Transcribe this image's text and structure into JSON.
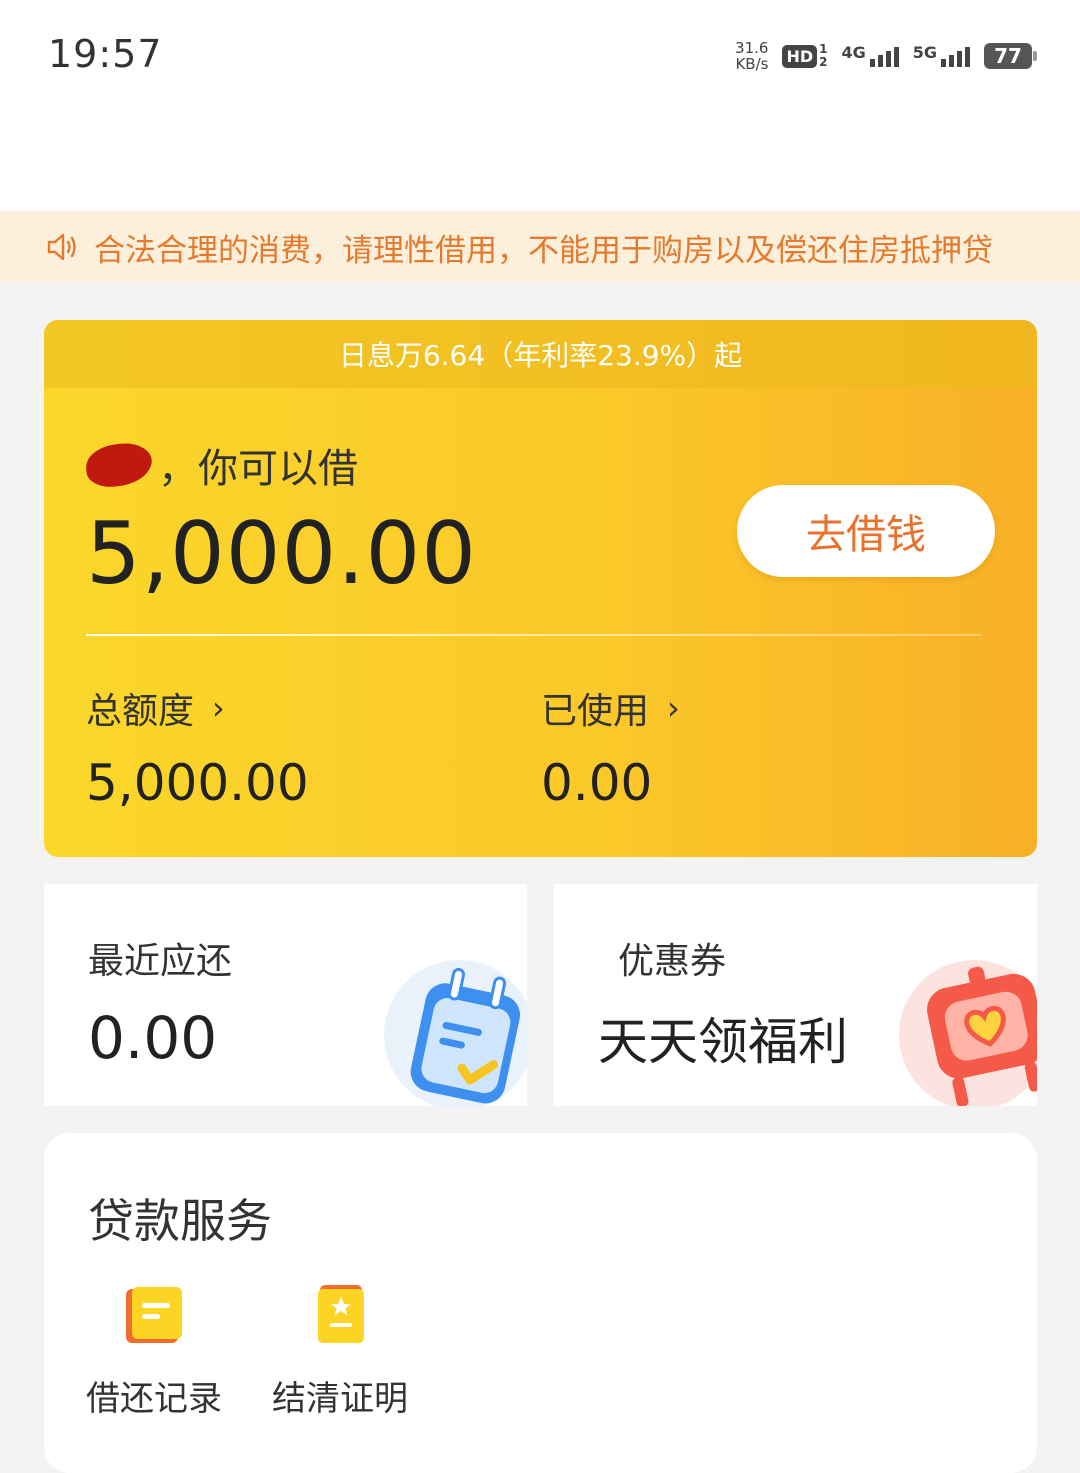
{
  "status_bar": {
    "time": "19:57",
    "net_speed_value": "31.6",
    "net_speed_unit": "KB/s",
    "hd_label": "HD",
    "hd_sub_top": "1",
    "hd_sub_bottom": "2",
    "sim1_label": "4G",
    "sim2_label": "5G",
    "battery": "77"
  },
  "notice": {
    "icon": "speaker-icon",
    "text": "合法合理的消费，请理性借用，不能用于购房以及偿还住房抵押贷"
  },
  "credit_card": {
    "rate_banner": "日息万6.64（年利率23.9%）起",
    "greeting_suffix": "，你可以借",
    "available_amount": "5,000.00",
    "borrow_button": "去借钱",
    "total_label": "总额度",
    "total_value": "5,000.00",
    "used_label": "已使用",
    "used_value": "0.00",
    "chevron": "›"
  },
  "repay_card": {
    "title": "最近应还",
    "value": "0.00",
    "icon": "calendar-icon"
  },
  "coupon_card": {
    "title": "优惠券",
    "subtitle": "天天领福利",
    "icon": "heart-gift-icon"
  },
  "loan_services": {
    "title": "贷款服务",
    "items": [
      {
        "label": "借还记录",
        "icon": "record-icon"
      },
      {
        "label": "结清证明",
        "icon": "certificate-icon"
      }
    ]
  },
  "colors": {
    "accent_orange": "#e8712c",
    "card_yellow": "#fbd72a",
    "notice_bg": "#fcf0dd"
  }
}
